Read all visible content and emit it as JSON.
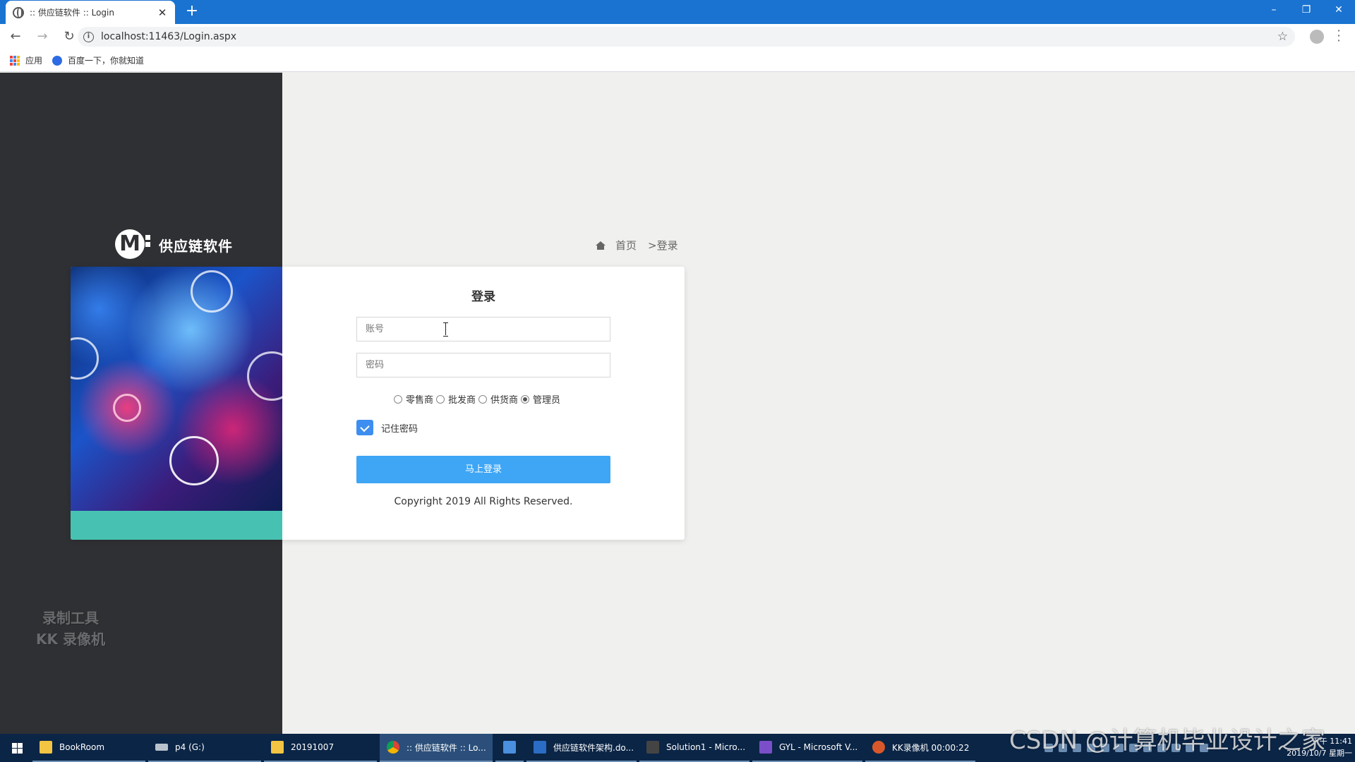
{
  "browser": {
    "tab_title": ":: 供应链软件 :: Login",
    "tab_close": "✕",
    "new_tab": "+",
    "window_controls": {
      "minimize": "–",
      "maximize": "❐",
      "close": "✕"
    },
    "nav": {
      "back": "←",
      "forward": "→",
      "reload": "↻"
    },
    "url": "localhost:11463/Login.aspx",
    "bookmarks": [
      {
        "label": "应用",
        "icon": "apps-grid-icon"
      },
      {
        "label": "百度一下，你就知道",
        "icon": "baidu-paw-icon"
      }
    ]
  },
  "brand": {
    "name": "供应链软件",
    "logo_letter": "M"
  },
  "breadcrumb": {
    "home": "首页",
    "current": ">登录"
  },
  "login": {
    "title": "登录",
    "account_placeholder": "账号",
    "password_placeholder": "密码",
    "roles": [
      {
        "label": "零售商",
        "checked": false
      },
      {
        "label": "批发商",
        "checked": false
      },
      {
        "label": "供货商",
        "checked": false
      },
      {
        "label": "管理员",
        "checked": true
      }
    ],
    "remember_label": "记住密码",
    "remember_checked": true,
    "submit_label": "马上登录",
    "copyright": "Copyright 2019 All Rights Reserved."
  },
  "watermark": {
    "line1": "录制工具",
    "line2": "KK 录像机"
  },
  "taskbar": {
    "items": [
      {
        "label": "BookRoom",
        "icon": "folder"
      },
      {
        "label": "p4 (G:)",
        "icon": "drive"
      },
      {
        "label": "20191007",
        "icon": "folder"
      },
      {
        "label": ":: 供应链软件 :: Lo...",
        "icon": "chrome",
        "active": true
      },
      {
        "label": "",
        "icon": "feather"
      },
      {
        "label": "供应链软件架构.do...",
        "icon": "word"
      },
      {
        "label": "Solution1 - Micro...",
        "icon": "vs"
      },
      {
        "label": "GYL - Microsoft V...",
        "icon": "vspurple"
      },
      {
        "label": "KK录像机 00:00:22",
        "icon": "kk"
      }
    ],
    "clock_time": "下午 11:41",
    "clock_date": "2019/10/7 星期一"
  },
  "overlay_watermark": "CSDN @计算机毕业设计之家",
  "colors": {
    "accent_blue": "#3ea6f5",
    "checkbox_blue": "#3d8ef0",
    "teal": "#47c2b2",
    "sidebar_dark": "#2f3033",
    "chrome_blue": "#1a73d0"
  }
}
